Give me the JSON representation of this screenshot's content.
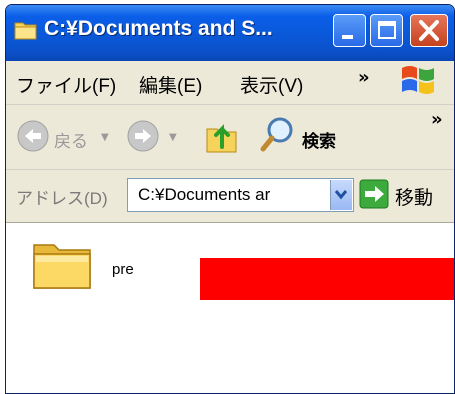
{
  "window": {
    "title": "C:¥Documents and S...",
    "colors": {
      "titlebar": "#0a58d8",
      "chrome": "#ece9d8",
      "close": "#c4421e"
    }
  },
  "menu": {
    "items": [
      "ファイル(F)",
      "編集(E)",
      "表示(V)"
    ],
    "overflow": "»"
  },
  "toolbar": {
    "back_label": "戻る",
    "search_label": "検索",
    "overflow": "»"
  },
  "address": {
    "label": "アドレス(D)",
    "value": "C:¥Documents ar",
    "go_label": "移動"
  },
  "content": {
    "items": [
      {
        "name": "pre",
        "icon": "folder-icon"
      }
    ],
    "highlight_color": "#ff0000"
  }
}
